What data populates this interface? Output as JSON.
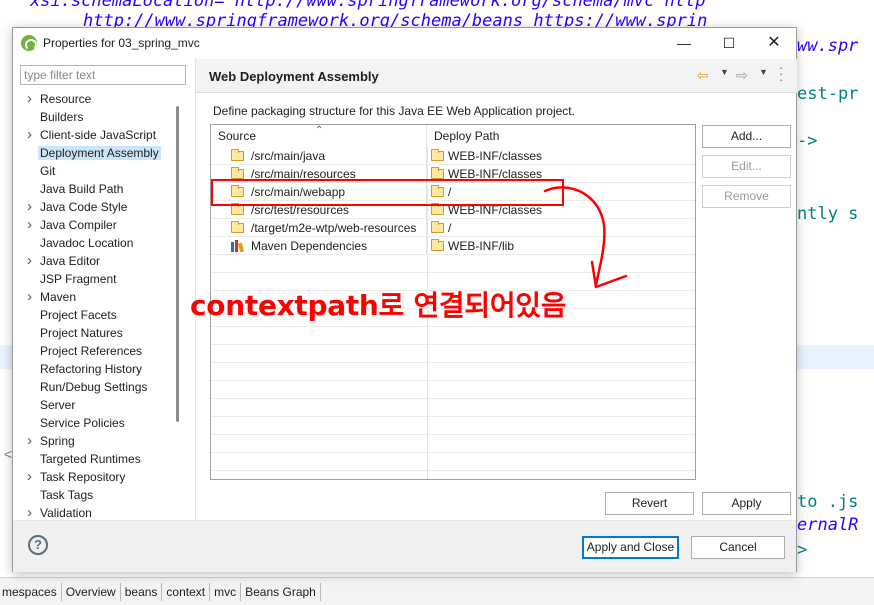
{
  "background": {
    "code_lines": [
      "xsi:schemaLocation=\"http://www.springframework.org/schema/mvc http",
      "http://www.springframework.org/schema/beans https://www.sprin",
      "ww.spr",
      "est-pr",
      "->",
      "ntly s",
      "to .js",
      "ernalR",
      ">"
    ],
    "bottom_tabs": [
      "mespaces",
      "Overview",
      "beans",
      "context",
      "mvc",
      "Beans Graph"
    ]
  },
  "dialog": {
    "title": "Properties for 03_spring_mvc",
    "filter_placeholder": "type filter text",
    "tree": [
      {
        "label": "Resource",
        "expandable": true,
        "selected": false
      },
      {
        "label": "Builders",
        "expandable": false,
        "selected": false
      },
      {
        "label": "Client-side JavaScript",
        "expandable": true,
        "selected": false
      },
      {
        "label": "Deployment Assembly",
        "expandable": false,
        "selected": true
      },
      {
        "label": "Git",
        "expandable": false,
        "selected": false
      },
      {
        "label": "Java Build Path",
        "expandable": false,
        "selected": false
      },
      {
        "label": "Java Code Style",
        "expandable": true,
        "selected": false
      },
      {
        "label": "Java Compiler",
        "expandable": true,
        "selected": false
      },
      {
        "label": "Javadoc Location",
        "expandable": false,
        "selected": false
      },
      {
        "label": "Java Editor",
        "expandable": true,
        "selected": false
      },
      {
        "label": "JSP Fragment",
        "expandable": false,
        "selected": false
      },
      {
        "label": "Maven",
        "expandable": true,
        "selected": false
      },
      {
        "label": "Project Facets",
        "expandable": false,
        "selected": false
      },
      {
        "label": "Project Natures",
        "expandable": false,
        "selected": false
      },
      {
        "label": "Project References",
        "expandable": false,
        "selected": false
      },
      {
        "label": "Refactoring History",
        "expandable": false,
        "selected": false
      },
      {
        "label": "Run/Debug Settings",
        "expandable": false,
        "selected": false
      },
      {
        "label": "Server",
        "expandable": false,
        "selected": false
      },
      {
        "label": "Service Policies",
        "expandable": false,
        "selected": false
      },
      {
        "label": "Spring",
        "expandable": true,
        "selected": false
      },
      {
        "label": "Targeted Runtimes",
        "expandable": false,
        "selected": false
      },
      {
        "label": "Task Repository",
        "expandable": true,
        "selected": false
      },
      {
        "label": "Task Tags",
        "expandable": false,
        "selected": false
      },
      {
        "label": "Validation",
        "expandable": true,
        "selected": false
      }
    ],
    "page": {
      "title": "Web Deployment Assembly",
      "description": "Define packaging structure for this Java EE Web Application project.",
      "columns": {
        "source": "Source",
        "deploy": "Deploy Path"
      },
      "rows": [
        {
          "source": "/src/main/java",
          "deploy": "WEB-INF/classes",
          "icon": "folder-icon"
        },
        {
          "source": "/src/main/resources",
          "deploy": "WEB-INF/classes",
          "icon": "folder-icon"
        },
        {
          "source": "/src/main/webapp",
          "deploy": "/",
          "icon": "folder-icon"
        },
        {
          "source": "/src/test/resources",
          "deploy": "WEB-INF/classes",
          "icon": "folder-icon"
        },
        {
          "source": "/target/m2e-wtp/web-resources",
          "deploy": "/",
          "icon": "folder-icon"
        },
        {
          "source": "Maven Dependencies",
          "deploy": "WEB-INF/lib",
          "icon": "library-icon"
        }
      ],
      "side_buttons": {
        "add": "Add...",
        "edit": "Edit...",
        "remove": "Remove"
      },
      "revert": "Revert",
      "apply": "Apply"
    },
    "footer": {
      "help": "?",
      "apply_close": "Apply and Close",
      "cancel": "Cancel"
    }
  },
  "annotation": {
    "text": "contextpath로 연결되어있음",
    "color": "#ff0000"
  }
}
